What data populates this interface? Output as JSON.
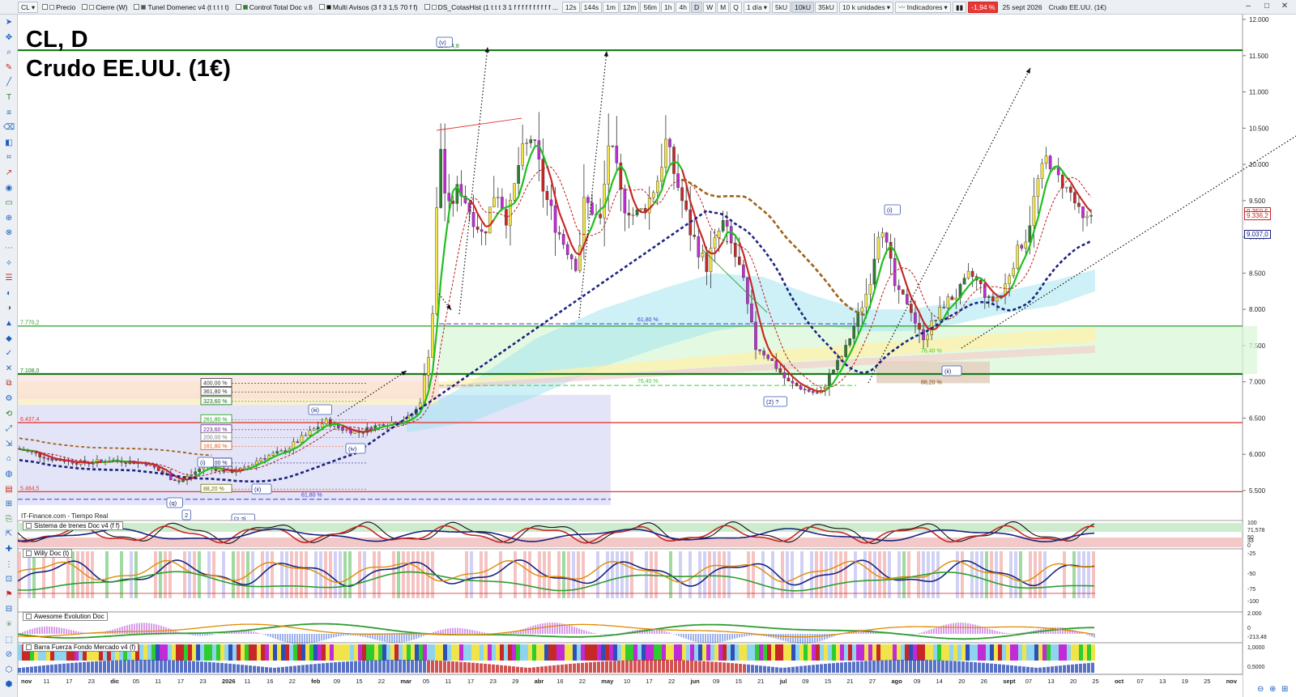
{
  "toolbar": {
    "symbol": "CL",
    "timeframes": [
      "12s",
      "144s",
      "1m",
      "12m",
      "56m",
      "1h",
      "4h",
      "D",
      "W",
      "M",
      "Q"
    ],
    "active_timeframe": "D",
    "period": "1 día",
    "units": [
      "5kU",
      "10kU",
      "35kU"
    ],
    "active_unit": "10kU",
    "units_select": "10 k unidades",
    "indicators_label": "Indicadores",
    "change_badge": "-1,94 %",
    "date_label": "25 sept 2026",
    "instrument_label": "Crudo EE.UU. (1€)",
    "overlay_indicators": [
      {
        "label": "Precio",
        "color": "#ffffff"
      },
      {
        "label": "Cierre (W)",
        "color": "#ffffff"
      },
      {
        "label": "Tunel Domenec v4 (t t t t t)",
        "color": "#555555"
      },
      {
        "label": "Control Total Doc v.6",
        "color": "#2e7d32"
      },
      {
        "label": "Multi Avisos (3 f 3 1,5 70 f f)",
        "color": "#111111"
      },
      {
        "label": "DS_CotasHist (1 t t t 3 1 f f f f f f f f f f ...",
        "color": "#ffffff"
      }
    ]
  },
  "chart": {
    "title_line1": "CL, D",
    "title_line2": "Crudo EE.UU. (1€)",
    "data_source": "IT-Finance.com - Tiempo Real",
    "y_axis_ticks": [
      "12.000",
      "11.500",
      "11.000",
      "10.500",
      "10.000",
      "9.500",
      "9.000",
      "8.500",
      "8.000",
      "7.500",
      "7.000",
      "6.500",
      "6.000",
      "5.500"
    ],
    "x_axis_ticks": [
      "nov",
      "11",
      "17",
      "23",
      "dic",
      "05",
      "11",
      "17",
      "23",
      "2026",
      "11",
      "16",
      "22",
      "feb",
      "09",
      "15",
      "22",
      "mar",
      "05",
      "11",
      "17",
      "23",
      "29",
      "abr",
      "16",
      "22",
      "may",
      "10",
      "17",
      "22",
      "jun",
      "09",
      "15",
      "21",
      "jul",
      "09",
      "15",
      "21",
      "27",
      "ago",
      "09",
      "14",
      "20",
      "26",
      "sept",
      "07",
      "13",
      "20",
      "25",
      "oct",
      "07",
      "13",
      "19",
      "25",
      "nov"
    ],
    "price_tags": [
      {
        "text": "9.350,5",
        "color": "#c62828",
        "bg": "#ffffff"
      },
      {
        "text": "9.336,2",
        "color": "#c62828",
        "bg": "#ffffff"
      },
      {
        "text": "9.037,0",
        "color": "#1a237e",
        "bg": "#ffffff"
      }
    ],
    "horizontal_levels": [
      {
        "price": 11574.8,
        "label": "11.574,8",
        "color": "#1b7a1b"
      },
      {
        "price": 7770.2,
        "label": "7.770,2",
        "color": "#2e9d2e"
      },
      {
        "price": 7108.0,
        "label": "7.108,0",
        "color": "#1b7a1b"
      },
      {
        "price": 6437.4,
        "label": "6.437,4",
        "color": "#e53935"
      },
      {
        "price": 5484.5,
        "label": "5.484,5",
        "color": "#e53935"
      }
    ],
    "fib_labels": [
      "400,00 %",
      "361,80 %",
      "323,60 %",
      "261,80 %",
      "223,60 %",
      "200,00 %",
      "161,80 %",
      "100,00 %",
      "88,20 %",
      "61,80 %",
      "61,80 %",
      "76,40 %",
      "76,40 %",
      "88,20 %"
    ],
    "wave_labels": [
      "(v)",
      "(i)",
      "(iii)",
      "(iv)",
      "(ii)",
      "(i)",
      "(ii)",
      "(q)",
      "2",
      "[2 ?]",
      "(i)",
      "(2) ?",
      "(ii)"
    ]
  },
  "sub_panels": [
    {
      "name": "Sistema de trenes Doc v4 (f f)",
      "axis": [
        "100",
        "71,578",
        "50",
        "33",
        "0"
      ]
    },
    {
      "name": "Willy Doc (t)",
      "axis": [
        "-25",
        "-50",
        "-75",
        "-100"
      ]
    },
    {
      "name": "Awesome Evolution Doc",
      "axis": [
        "2.000",
        "0",
        "-213,48"
      ]
    },
    {
      "name": "Barra Fuerza Fondo Mercado v4 (f)",
      "axis": [
        "1,0000",
        "0,5000"
      ]
    }
  ],
  "colors": {
    "accent_green": "#1b7a1b",
    "accent_red": "#e53935",
    "accent_blue": "#1a237e",
    "badge_red": "#e53935"
  },
  "icons": {
    "window_controls": [
      "minimize-icon",
      "maximize-icon",
      "close-icon"
    ],
    "left_tools": [
      "cursor-icon",
      "crosshair-icon",
      "zoom-icon",
      "draw-icon",
      "line-icon",
      "text-icon",
      "fibonacci-icon",
      "delete-icon"
    ]
  }
}
